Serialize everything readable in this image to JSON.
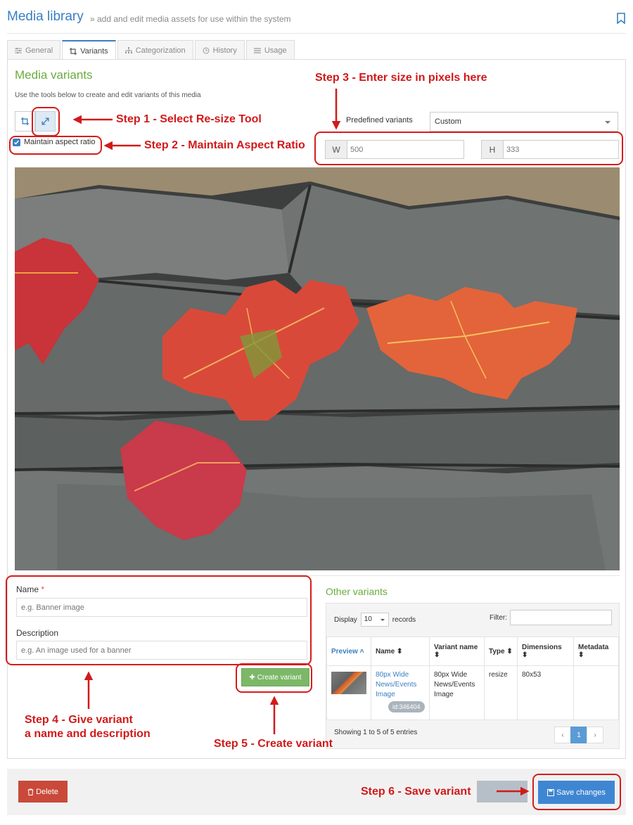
{
  "header": {
    "title": "Media library",
    "subtitle": "» add and edit media assets for use within the system"
  },
  "tabs": [
    {
      "label": "General",
      "icon": "sliders-icon"
    },
    {
      "label": "Variants",
      "icon": "crop-icon",
      "active": true
    },
    {
      "label": "Categorization",
      "icon": "sitemap-icon"
    },
    {
      "label": "History",
      "icon": "clock-icon"
    },
    {
      "label": "Usage",
      "icon": "list-icon"
    }
  ],
  "variants": {
    "title": "Media variants",
    "description": "Use the tools below to create and edit variants of this media",
    "maintain_aspect_label": "Maintain aspect ratio",
    "maintain_aspect_checked": true,
    "predefined_label": "Predefined variants",
    "predefined_value": "Custom",
    "width_addon": "W",
    "width_value": "500",
    "height_addon": "H",
    "height_value": "333"
  },
  "form": {
    "name_label": "Name",
    "required_mark": "*",
    "name_placeholder": "e.g. Banner image",
    "description_label": "Description",
    "description_placeholder": "e.g. An image used for a banner",
    "create_button": "Create variant"
  },
  "other_variants": {
    "title": "Other variants",
    "display_label": "Display",
    "records_count": "10",
    "records_label": "records",
    "filter_label": "Filter:",
    "columns": [
      "Preview",
      "Name",
      "Variant name",
      "Type",
      "Dimensions",
      "Metadata"
    ],
    "rows": [
      {
        "name": "80px Wide News/Events Image",
        "id_badge": "id:346404",
        "variant_name": "80px Wide News/Events Image",
        "type": "resize",
        "dimensions": "80x53",
        "metadata": ""
      }
    ],
    "info": "Showing 1 to 5 of 5 entries",
    "pager": {
      "prev": "‹",
      "current": "1",
      "next": "›"
    }
  },
  "footer": {
    "delete_button": "Delete",
    "save_button": "Save changes"
  },
  "annotations": {
    "step1": "Step 1 - Select Re-size Tool",
    "step2": "Step 2 - Maintain Aspect Ratio",
    "step3": "Step 3 - Enter size in pixels here",
    "step4_line1": "Step 4 - Give variant",
    "step4_line2": "a name and description",
    "step5": "Step 5 - Create variant",
    "step6": "Step 6 - Save variant"
  },
  "colors": {
    "accent_blue": "#3a7fc1",
    "section_green": "#6aac3e",
    "annotation_red": "#d11a1a",
    "delete_red": "#c9493a",
    "save_blue": "#3f86d2"
  }
}
